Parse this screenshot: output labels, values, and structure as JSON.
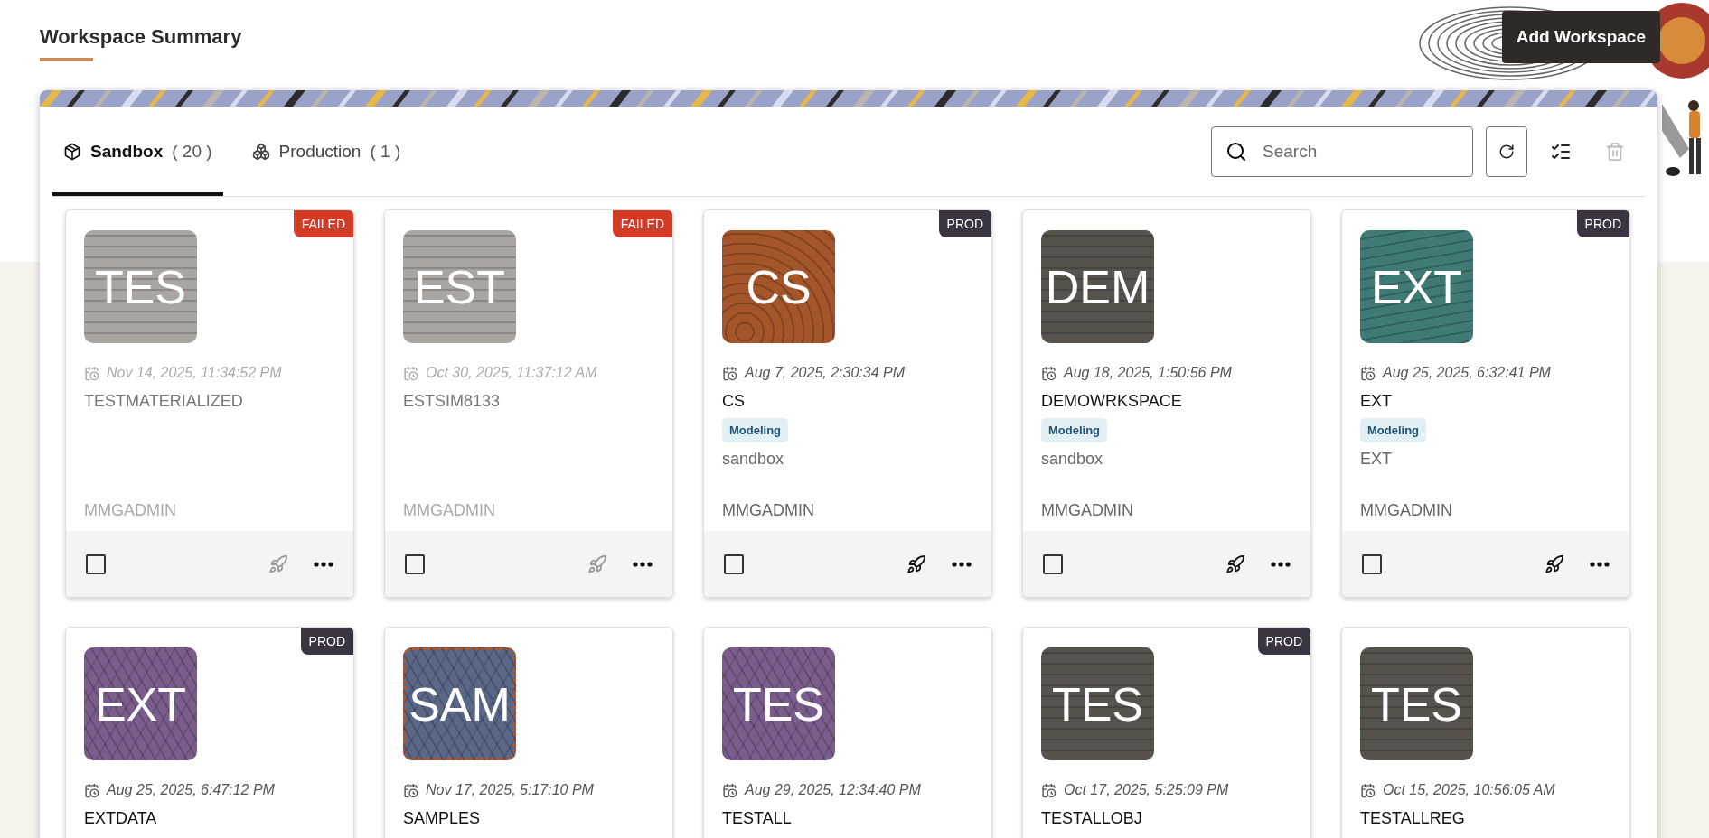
{
  "page": {
    "title": "Workspace Summary",
    "add_button": "Add Workspace"
  },
  "tabs": [
    {
      "kind": "sandbox",
      "label": "Sandbox",
      "count": "( 20 )",
      "selected": true
    },
    {
      "kind": "production",
      "label": "Production",
      "count": "( 1 )",
      "selected": false
    }
  ],
  "toolbar": {
    "search": {
      "placeholder": "Search"
    },
    "delete_disabled": true
  },
  "cards": [
    {
      "initials": "TES",
      "color": "#a9a6a2",
      "kind": "dash",
      "focused": false,
      "badge": {
        "kind": "failed",
        "label": "FAILED"
      },
      "date": "Nov 14, 2025, 11:34:52 PM",
      "name": "TESTMATERIALIZED",
      "owner": "MMGADMIN",
      "actions": {
        "checked": false,
        "launch_disabled": true
      }
    },
    {
      "initials": "EST",
      "color": "#a9a6a2",
      "kind": "dash",
      "focused": false,
      "badge": {
        "kind": "failed",
        "label": "FAILED"
      },
      "date": "Oct 30, 2025, 11:37:12 AM",
      "name": "ESTSIM8133",
      "owner": "MMGADMIN",
      "actions": {
        "checked": false,
        "launch_disabled": true
      }
    },
    {
      "initials": "CS",
      "color": "#a5552a",
      "kind": "rings",
      "focused": false,
      "badge": {
        "kind": "prod",
        "label": "PROD"
      },
      "date": "Aug 7, 2025, 2:30:34 PM",
      "name": "CS",
      "tag": "Modeling",
      "description": "sandbox",
      "owner": "MMGADMIN",
      "actions": {
        "checked": false,
        "launch_disabled": false
      }
    },
    {
      "initials": "DEM",
      "color": "#57524b",
      "kind": "dash",
      "focused": false,
      "date": "Aug 18, 2025, 1:50:56 PM",
      "name": "DEMOWRKSPACE",
      "tag": "Modeling",
      "description": "sandbox",
      "owner": "MMGADMIN",
      "actions": {
        "checked": false,
        "launch_disabled": false
      }
    },
    {
      "initials": "EXT",
      "color": "#3f7a74",
      "kind": "waves",
      "focused": false,
      "badge": {
        "kind": "prod",
        "label": "PROD"
      },
      "date": "Aug 25, 2025, 6:32:41 PM",
      "name": "EXT",
      "tag": "Modeling",
      "description": "EXT",
      "owner": "MMGADMIN",
      "actions": {
        "checked": false,
        "launch_disabled": false
      }
    },
    {
      "initials": "EXT",
      "color": "#7a5d8c",
      "kind": "hatch",
      "focused": false,
      "badge": {
        "kind": "prod",
        "label": "PROD"
      },
      "date": "Aug 25, 2025, 6:47:12 PM",
      "name": "EXTDATA"
    },
    {
      "initials": "SAM",
      "color": "#5a6787",
      "kind": "hatch",
      "focused": true,
      "date": "Nov 17, 2025, 5:17:10 PM",
      "name": "SAMPLES"
    },
    {
      "initials": "TES",
      "color": "#7a5d8c",
      "kind": "hatch",
      "focused": false,
      "date": "Aug 29, 2025, 12:34:40 PM",
      "name": "TESTALL"
    },
    {
      "initials": "TES",
      "color": "#57524b",
      "kind": "dash",
      "focused": false,
      "badge": {
        "kind": "prod",
        "label": "PROD"
      },
      "date": "Oct 17, 2025, 5:25:09 PM",
      "name": "TESTALLOBJ"
    },
    {
      "initials": "TES",
      "color": "#57524b",
      "kind": "dash",
      "focused": false,
      "date": "Oct 15, 2025, 10:56:05 AM",
      "name": "TESTALLREG"
    }
  ]
}
